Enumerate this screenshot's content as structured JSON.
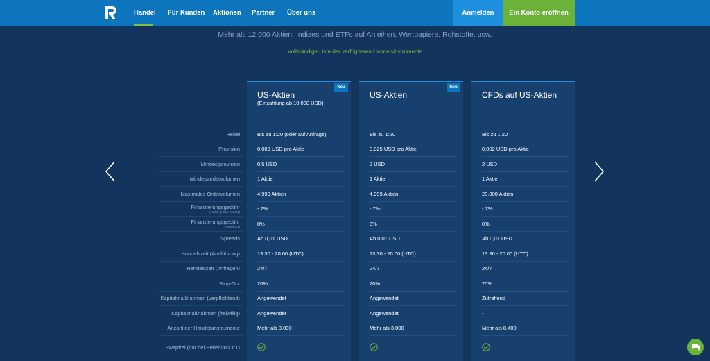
{
  "nav": {
    "items": [
      {
        "label": "Handel"
      },
      {
        "label": "Für Kunden"
      },
      {
        "label": "Aktionen"
      },
      {
        "label": "Partner"
      },
      {
        "label": "Über uns"
      }
    ],
    "login_label": "Anmelden",
    "open_account_label": "Ein Konto eröffnen",
    "colors": {
      "bar": "#0c75bd",
      "login": "#1d8fdc",
      "open": "#6ab338",
      "active": "#7fc13c"
    }
  },
  "hero": {
    "subtitle": "Mehr als 12.000 Aktien, Indizes und ETFs auf Anleihen, Wertpapiere, Rohstoffe, usw.",
    "link": "Vollständige Liste der verfügbaren Handelsinstrumente"
  },
  "labels": [
    {
      "main": "Hebel"
    },
    {
      "main": "Provision"
    },
    {
      "main": "Mindestprovision"
    },
    {
      "main": "Mindestordervolumen"
    },
    {
      "main": "Maximales Ordervolumen"
    },
    {
      "main": "Finanzierungsgebühr",
      "note": "(Hebel größer als 1:1)"
    },
    {
      "main": "Finanzierungsgebühr",
      "note": "(Hebel 1:1)"
    },
    {
      "main": "Spreads"
    },
    {
      "main": "Handelszeit (Ausführung)"
    },
    {
      "main": "Handelszeit (Anfragen)"
    },
    {
      "main": "Stop-Out"
    },
    {
      "main": "Kapitalmaßnahmen (verpflichtend)"
    },
    {
      "main": "Kapitalmaßnahmen (freiwillig)"
    },
    {
      "main": "Anzahl der Handelsinstrumente"
    },
    {
      "main": "Swapfrei (nur bei Hebel von 1:1)"
    }
  ],
  "products": [
    {
      "title": "US-Aktien",
      "subtitle": "(Einzahlung ab 10.000 USD)",
      "badge": "Neu",
      "values": [
        "Bis zu 1:20 (oder auf Anfrage)",
        "0,009 USD pro Aktie",
        "0,5 USD",
        "1 Aktie",
        "4.999 Aktien",
        "- 7%",
        "0%",
        "Ab 0,01 USD",
        "13:30 - 20:00 (UTC)",
        "24/7",
        "20%",
        "Angewendet",
        "Angewendet",
        "Mehr als 3.000"
      ],
      "swap_free_icon": "check-circle-icon"
    },
    {
      "title": "US-Aktien",
      "subtitle": "",
      "badge": "Neu",
      "values": [
        "Bis zu 1:20",
        "0,025 USD pro Aktie",
        "2 USD",
        "1 Aktie",
        "4.999 Aktien",
        "- 7%",
        "0%",
        "Ab 0,01 USD",
        "13:30 - 20:00 (UTC)",
        "24/7",
        "20%",
        "Angewendet",
        "Angewendet",
        "Mehr als 3.000"
      ],
      "swap_free_icon": "check-circle-icon"
    },
    {
      "title": "CFDs auf US-Aktien",
      "subtitle": "",
      "badge": "",
      "values": [
        "Bis zu 1:20",
        "0,002 USD pro Aktie",
        "2 USD",
        "1 Aktie",
        "20.000 Aktien",
        "- 7%",
        "0%",
        "Ab 0,01 USD",
        "13:30 - 20:00 (UTC)",
        "24/7",
        "20%",
        "Zutreffend",
        "-",
        "Mehr als 8.400"
      ],
      "swap_free_icon": "check-circle-icon"
    }
  ],
  "theme": {
    "background": "#13345c",
    "card": "#18406f",
    "check": "#6ab338"
  }
}
